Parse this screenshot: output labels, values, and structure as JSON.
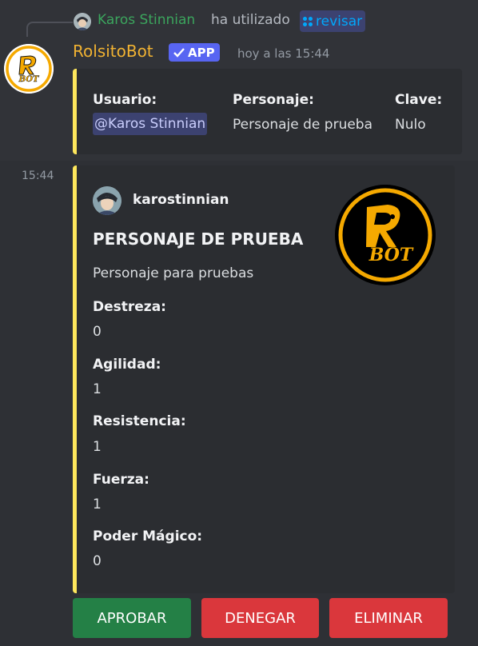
{
  "reply": {
    "user": "Karos Stinnian",
    "verb": "ha utilizado",
    "command": "revisar"
  },
  "message": {
    "bot_name": "RolsitoBot",
    "badge": "APP",
    "timestamp": "hoy a las 15:44",
    "side_time": "15:44"
  },
  "embed1": {
    "fields": [
      {
        "name": "Usuario:",
        "value": "@Karos Stinnian"
      },
      {
        "name": "Personaje:",
        "value": "Personaje de prueba"
      },
      {
        "name": "Clave:",
        "value": "Nulo"
      }
    ]
  },
  "embed2": {
    "author": "karostinnian",
    "title": "PERSONAJE DE PRUEBA",
    "description": "Personaje para pruebas",
    "fields": [
      {
        "name": "Destreza:",
        "value": "0"
      },
      {
        "name": "Agilidad:",
        "value": "1"
      },
      {
        "name": "Resistencia:",
        "value": "1"
      },
      {
        "name": "Fuerza:",
        "value": "1"
      },
      {
        "name": "Poder Mágico:",
        "value": "0"
      }
    ],
    "logo_text": "BOT"
  },
  "buttons": {
    "approve": "APROBAR",
    "deny": "DENEGAR",
    "delete": "ELIMINAR"
  },
  "colors": {
    "embed_accent": "#fee75c",
    "bot_name": "#f0b232",
    "reply_user": "#3ba55d",
    "approve": "#248046",
    "danger": "#da373c"
  }
}
